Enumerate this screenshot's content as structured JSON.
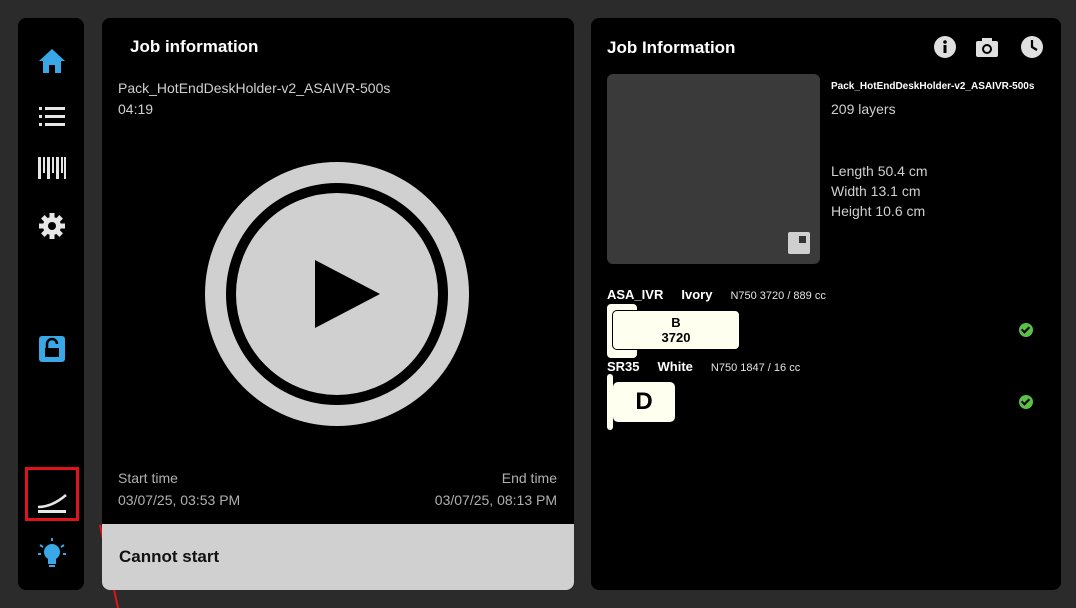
{
  "left": {
    "title": "Job information",
    "job_name": "Pack_HotEndDeskHolder-v2_ASAIVR-500s",
    "duration": "04:19",
    "start_label": "Start time",
    "start_value": "03/07/25, 03:53 PM",
    "end_label": "End time",
    "end_value": "03/07/25, 08:13 PM",
    "status_button": "Cannot start"
  },
  "right": {
    "title": "Job Information",
    "job_name": "Pack_HotEndDeskHolder-v2_ASAIVR-500s",
    "layers": "209 layers",
    "length": "Length 50.4 cm",
    "width": "Width 13.1 cm",
    "height": "Height 10.6 cm",
    "materials": [
      {
        "name": "ASA_IVR",
        "color": "Ivory",
        "info": "N750 3720 / 889 cc",
        "slot": "B",
        "amount": "3720"
      },
      {
        "name": "SR35",
        "color": "White",
        "info": "N750 1847 / 16 cc",
        "slot": "D"
      }
    ]
  },
  "icons": {
    "home": "home-icon",
    "list": "list-icon",
    "barcode": "barcode-icon",
    "gear": "gear-icon",
    "lock": "unlock-icon",
    "level": "calibration-icon",
    "light": "lightbulb-icon",
    "info": "info-icon",
    "camera": "camera-icon",
    "clock": "clock-icon"
  },
  "colors": {
    "accent": "#3aa8e6",
    "highlight": "#e0121b",
    "ok": "#5cbf4a"
  }
}
